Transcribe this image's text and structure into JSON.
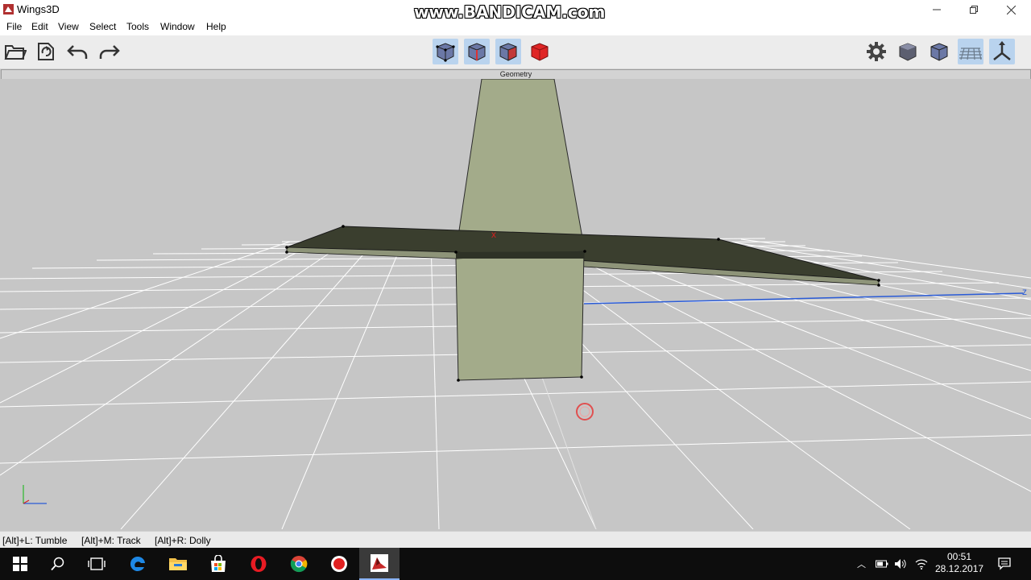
{
  "window": {
    "title": "Wings3D",
    "watermark": "www.BANDICAM.com"
  },
  "menu": {
    "items": [
      "File",
      "Edit",
      "View",
      "Select",
      "Tools",
      "Window",
      "Help"
    ]
  },
  "viewport": {
    "header": "Geometry",
    "axis_labels": {
      "x": "x",
      "z": "z"
    }
  },
  "status": {
    "tumble": "[Alt]+L: Tumble",
    "track": "[Alt]+M: Track",
    "dolly": "[Alt]+R: Dolly"
  },
  "taskbar": {
    "time": "00:51",
    "date": "28.12.2017"
  },
  "icons": {
    "toolbar_left": [
      "open-folder-icon",
      "save-icon",
      "undo-icon",
      "redo-icon"
    ],
    "selection_modes": [
      "vertex-mode-icon",
      "edge-mode-icon",
      "face-mode-icon",
      "body-mode-icon"
    ],
    "toolbar_right": [
      "gear-icon",
      "smooth-preview-icon",
      "wireframe-cube-icon",
      "ground-grid-icon",
      "axes-icon"
    ],
    "taskbar": [
      "windows-start-icon",
      "search-icon",
      "task-view-icon",
      "edge-browser-icon",
      "file-explorer-icon",
      "store-icon",
      "opera-icon",
      "chrome-icon",
      "bandicam-icon",
      "wings3d-icon"
    ]
  },
  "colors": {
    "face": "#a3ab8a",
    "dark_face": "#3a3e2e",
    "grid_bg": "#c6c6c6",
    "selected_tool": "#b9d3ee"
  }
}
